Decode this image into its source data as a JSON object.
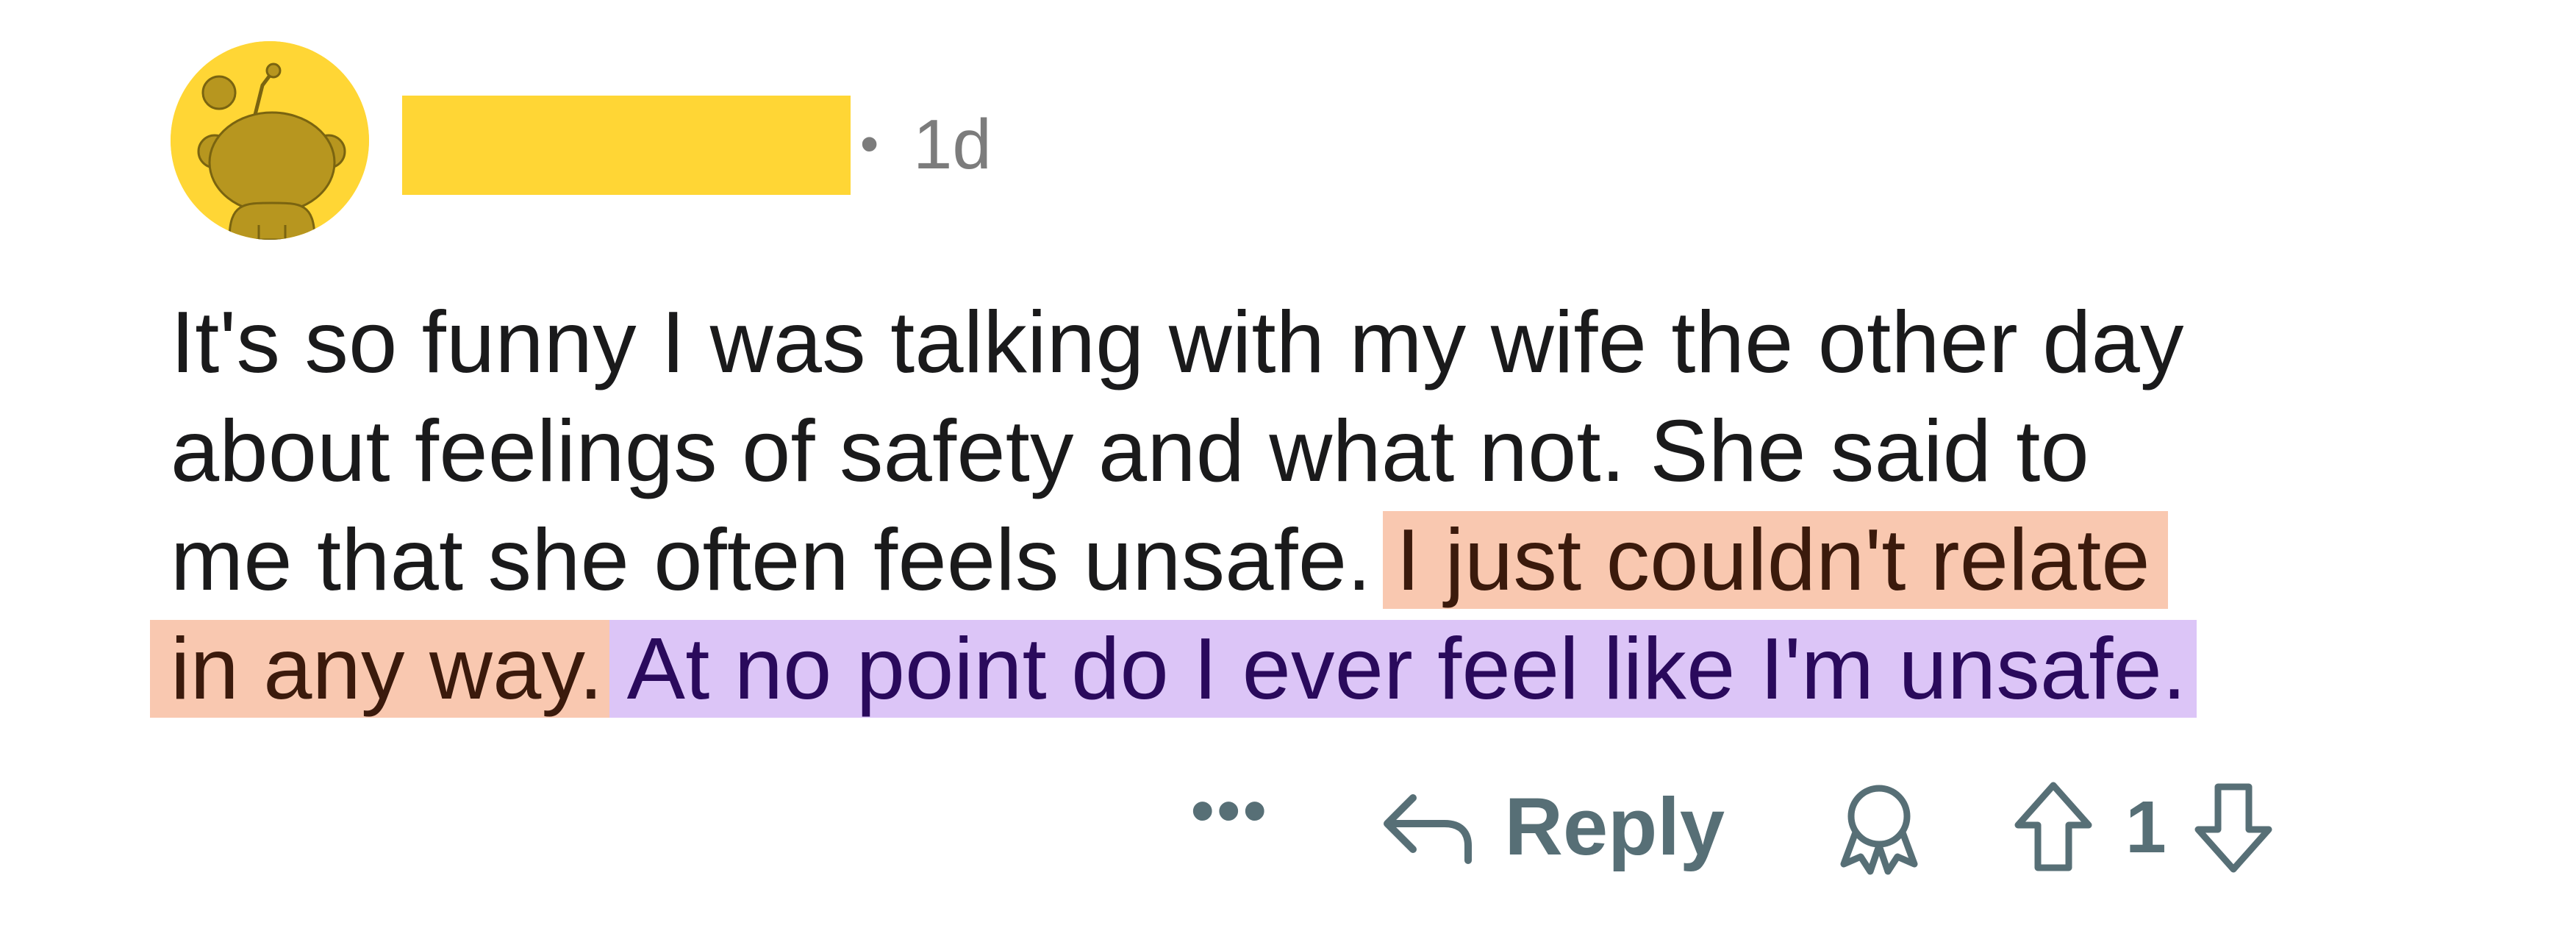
{
  "colors": {
    "avatar_bg": "#ffd635",
    "username_redaction": "#ffd635",
    "highlight_orange": "#f9c8b0",
    "highlight_purple": "#dcc5f7",
    "meta_text": "#7c7c7c",
    "action_text": "#576f76"
  },
  "header": {
    "avatar_icon": "snoo-avatar-icon",
    "separator": "•",
    "timestamp": "1d"
  },
  "comment": {
    "lines": [
      "It's so funny I was talking with my wife the other day",
      "about feelings of safety and what not. She said to",
      "me that she often feels unsafe."
    ],
    "highlight_orange_part1": "I just couldn't relate",
    "highlight_orange_part2": "in any way.",
    "highlight_purple": "At no point do I ever feel like I'm unsafe."
  },
  "actions": {
    "more_label": "•••",
    "reply_label": "Reply",
    "vote_count": "1"
  }
}
